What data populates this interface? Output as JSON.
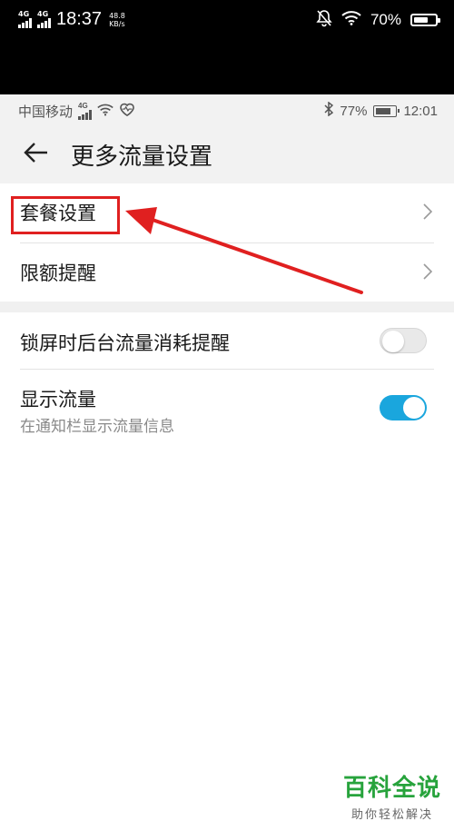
{
  "outer_status": {
    "network_1": "4G",
    "network_2": "4G",
    "time": "18:37",
    "speed_value": "48.8",
    "speed_unit": "KB/s",
    "battery_pct": "70%",
    "battery_level": 0.7
  },
  "inner_status": {
    "carrier": "中国移动",
    "network": "4G",
    "battery_pct": "77%",
    "battery_level": 0.77,
    "time": "12:01"
  },
  "header": {
    "title": "更多流量设置"
  },
  "settings": {
    "group1": [
      {
        "label": "套餐设置"
      },
      {
        "label": "限额提醒"
      }
    ],
    "group2": [
      {
        "label": "锁屏时后台流量消耗提醒",
        "toggle": "off"
      },
      {
        "label": "显示流量",
        "sublabel": "在通知栏显示流量信息",
        "toggle": "on"
      }
    ]
  },
  "colors": {
    "accent_toggle": "#1aa6dd",
    "annotation_red": "#e02020",
    "watermark_green": "#27a33c"
  },
  "icons": [
    "back-arrow-icon",
    "chevron-right-icon",
    "wifi-icon",
    "bluetooth-icon",
    "battery-icon",
    "heart-rate-icon",
    "mute-bell-icon",
    "signal-icon"
  ],
  "watermark": {
    "main": "百科全说",
    "sub": "助你轻松解决"
  }
}
